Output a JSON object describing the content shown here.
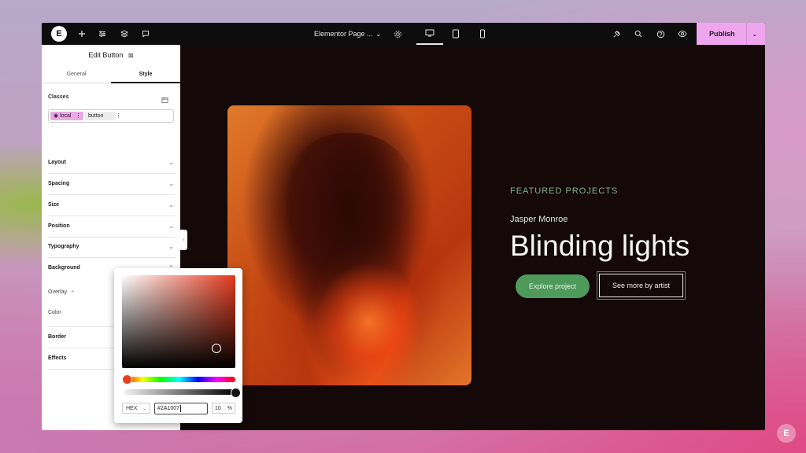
{
  "topbar": {
    "logo": "E",
    "page_title": "Elementor Page ...",
    "publish_label": "Publish"
  },
  "panel": {
    "title": "Edit Button",
    "tabs": [
      {
        "label": "General"
      },
      {
        "label": "Style"
      }
    ],
    "active_tab": "Style",
    "classes_label": "Classes",
    "class_chips": [
      "local",
      "button"
    ],
    "sections": [
      {
        "label": "Layout"
      },
      {
        "label": "Spacing"
      },
      {
        "label": "Size"
      },
      {
        "label": "Position"
      },
      {
        "label": "Typography"
      },
      {
        "label": "Background"
      },
      {
        "label": "Border"
      },
      {
        "label": "Effects"
      }
    ],
    "background": {
      "overlay_label": "Overlay",
      "overlay_add": "+",
      "color_label": "Color"
    }
  },
  "canvas": {
    "eyebrow": "FEATURED PROJECTS",
    "artist": "Jasper Monroe",
    "headline": "Blinding lights",
    "primary_button": "Explore project",
    "secondary_button": "See more by artist"
  },
  "color_picker": {
    "format": "HEX",
    "hex_value": "#2A1007",
    "opacity_value": "10",
    "opacity_unit": "%",
    "hue_color": "#e23a1c"
  },
  "colors": {
    "accent": "#f0a6ee",
    "canvas_bg": "#140808",
    "eyebrow": "#7fb58a",
    "explore_button": "#4e9a5a"
  }
}
